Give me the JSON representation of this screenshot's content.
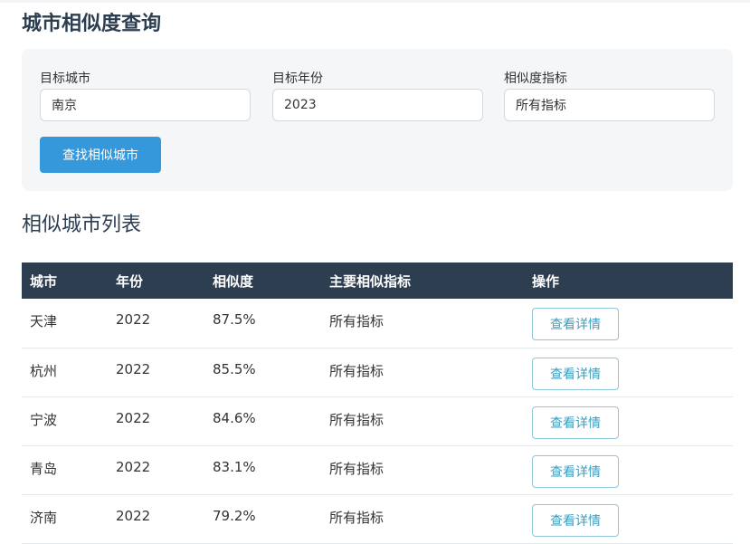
{
  "page_title": "城市相似度查询",
  "search": {
    "fields": [
      {
        "label": "目标城市",
        "value": "南京"
      },
      {
        "label": "目标年份",
        "value": "2023"
      },
      {
        "label": "相似度指标",
        "value": "所有指标"
      }
    ],
    "submit_label": "查找相似城市"
  },
  "results": {
    "title": "相似城市列表",
    "columns": [
      "城市",
      "年份",
      "相似度",
      "主要相似指标",
      "操作"
    ],
    "rows": [
      {
        "city": "天津",
        "year": "2022",
        "similarity": "87.5%",
        "indicator": "所有指标",
        "action": "查看详情"
      },
      {
        "city": "杭州",
        "year": "2022",
        "similarity": "85.5%",
        "indicator": "所有指标",
        "action": "查看详情"
      },
      {
        "city": "宁波",
        "year": "2022",
        "similarity": "84.6%",
        "indicator": "所有指标",
        "action": "查看详情"
      },
      {
        "city": "青岛",
        "year": "2022",
        "similarity": "83.1%",
        "indicator": "所有指标",
        "action": "查看详情"
      },
      {
        "city": "济南",
        "year": "2022",
        "similarity": "79.2%",
        "indicator": "所有指标",
        "action": "查看详情"
      }
    ]
  },
  "colors": {
    "header_bg": "#2c3e50",
    "primary": "#3498db",
    "card_bg": "#f4f6f8"
  }
}
